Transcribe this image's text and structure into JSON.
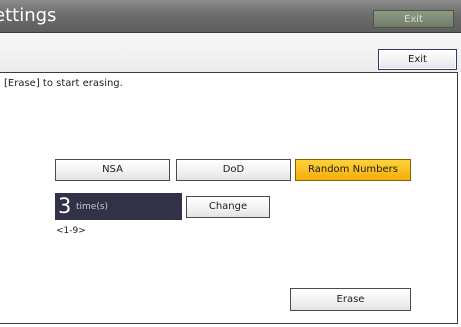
{
  "header": {
    "title": "ettings",
    "exit_label": "Exit"
  },
  "toolbar": {
    "exit_label": "Exit"
  },
  "main": {
    "instruction": "[Erase] to start erasing.",
    "methods": [
      {
        "label": "NSA",
        "selected": false
      },
      {
        "label": "DoD",
        "selected": false
      },
      {
        "label": "Random Numbers",
        "selected": true
      }
    ],
    "times": {
      "value": "3",
      "unit": "time(s)",
      "range": "<1-9>"
    },
    "change_label": "Change",
    "erase_label": "Erase"
  },
  "colors": {
    "title_bar": "#6d6d6d",
    "selected_method": "#f4ad0c",
    "times_display": "#313148"
  }
}
